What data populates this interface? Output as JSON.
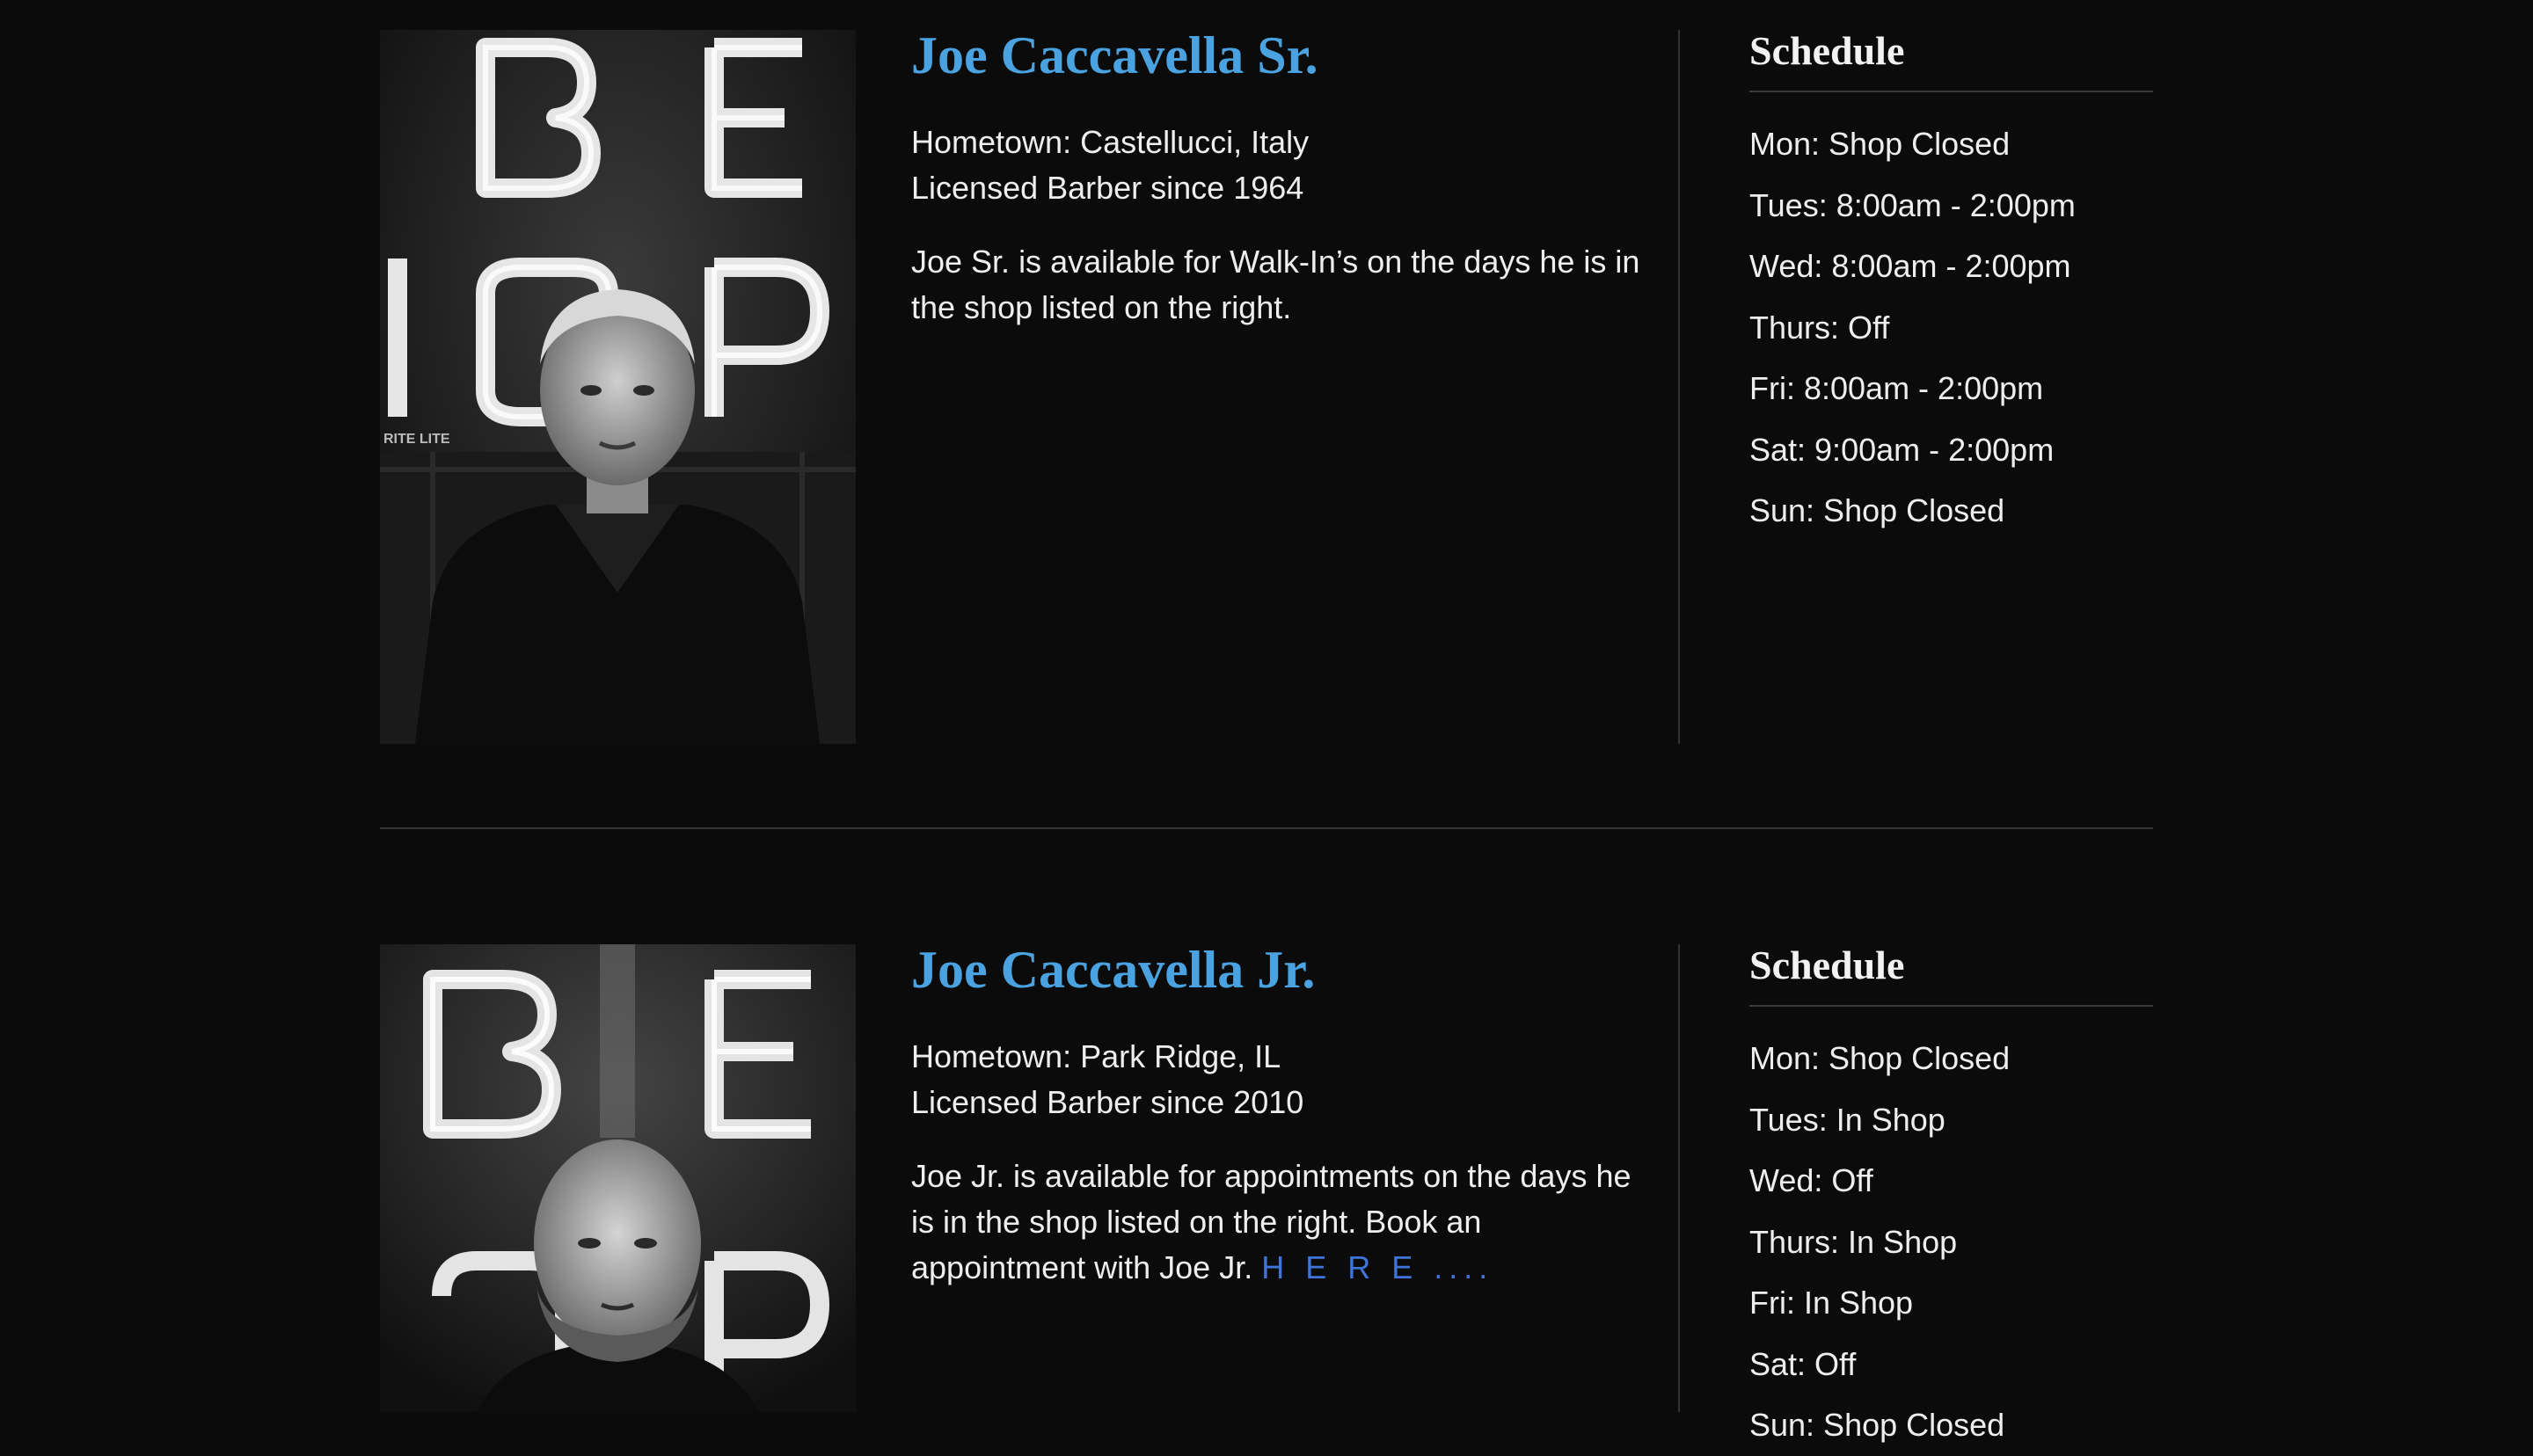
{
  "barbers": [
    {
      "name": "Joe Caccavella Sr.",
      "hometown": "Hometown: Castellucci, Italy",
      "licensed": "Licensed Barber since 1964",
      "bio": "Joe Sr. is available for Walk-In’s on the days he is in the shop listed on the right.",
      "photo_sign_small_text": "RITE LITE",
      "schedule_title": "Schedule",
      "schedule": [
        "Mon: Shop Closed",
        "Tues: 8:00am - 2:00pm",
        "Wed: 8:00am - 2:00pm",
        "Thurs: Off",
        "Fri: 8:00am - 2:00pm",
        "Sat: 9:00am - 2:00pm",
        "Sun: Shop Closed"
      ]
    },
    {
      "name": "Joe Caccavella Jr.",
      "hometown": "Hometown: Park Ridge, IL",
      "licensed": "Licensed Barber since 2010",
      "bio": "Joe Jr. is available for appointments on the days he is in the shop listed on the right. Book an appointment with Joe Jr.",
      "bio_link": "H E R E ....",
      "schedule_title": "Schedule",
      "schedule": [
        "Mon: Shop Closed",
        "Tues: In Shop",
        "Wed: Off",
        "Thurs: In Shop",
        "Fri: In Shop",
        "Sat: Off",
        "Sun: Shop Closed"
      ]
    }
  ],
  "colors": {
    "background": "#0b0b0c",
    "name_accent": "#4aa3e0",
    "link": "#3f74d8",
    "text": "#eeeeee",
    "rule": "#333333"
  }
}
